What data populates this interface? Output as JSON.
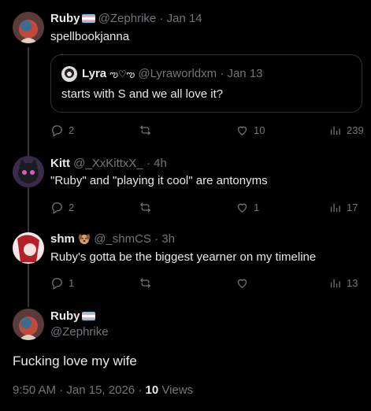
{
  "replies": [
    {
      "name": "Ruby",
      "handle": "@Zephrike",
      "dot": "·",
      "time": "Jan 14",
      "text": "spellbookjanna",
      "quote": {
        "name": "Lyra",
        "name_deco": "ఌ︎♡ఌ︎",
        "handle": "@Lyraworldxm",
        "dot": "·",
        "time": "Jan 13",
        "text": "starts with S and we all love it?"
      },
      "stats": {
        "replies": "2",
        "reposts": "",
        "likes": "10",
        "views": "239"
      }
    },
    {
      "name": "Kitt",
      "handle": "@_XxKittxX_",
      "dot": "·",
      "time": "4h",
      "text": "\"Ruby\" and \"playing it cool\" are antonyms",
      "stats": {
        "replies": "2",
        "reposts": "",
        "likes": "1",
        "views": "17"
      }
    },
    {
      "name": "shm",
      "handle": "@_shmCS",
      "dot": "·",
      "time": "3h",
      "text": "Ruby's gotta be the biggest yearner on my timeline",
      "stats": {
        "replies": "1",
        "reposts": "",
        "likes": "",
        "views": "13"
      }
    }
  ],
  "main_post": {
    "name": "Ruby",
    "handle": "@Zephrike",
    "text": "Fucking love my wife",
    "time": "9:50 AM",
    "date": "Jan 15, 2026",
    "dot": "·",
    "views_count": "10",
    "views_label": "Views"
  },
  "colors": {
    "background": "#000000",
    "text": "#e7e9ea",
    "secondary": "#71767b",
    "border": "#2f3336",
    "flag": [
      "#5bcefa",
      "#f5a9b8",
      "#ffffff",
      "#f5a9b8",
      "#5bcefa"
    ]
  },
  "icons": [
    "reply-icon",
    "repost-icon",
    "like-icon",
    "views-icon",
    "dog-face-emoji"
  ]
}
